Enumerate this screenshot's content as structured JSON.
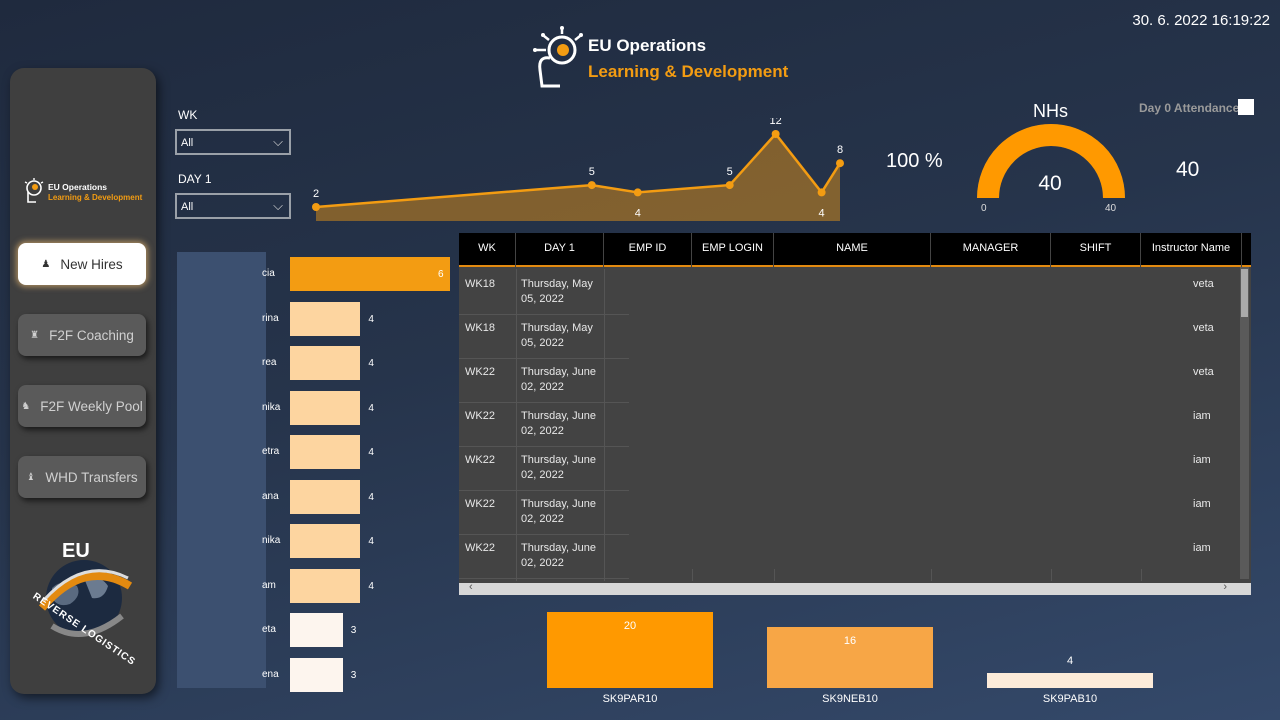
{
  "header": {
    "title_line1": "EU Operations",
    "title_line2": "Learning & Development",
    "datetime": "30. 6. 2022 16:19:22"
  },
  "sidebar": {
    "logo_line1": "EU Operations",
    "logo_line2": "Learning & Development",
    "nav": [
      {
        "label": "New Hires",
        "icon": "person-icon"
      },
      {
        "label": "F2F Coaching",
        "icon": "chess-icon"
      },
      {
        "label": "F2F Weekly Pool",
        "icon": "chess-icon"
      },
      {
        "label": "WHD Transfers",
        "icon": "chess-icon"
      }
    ],
    "brand_top": "EU",
    "brand_ring": "REVERSE LOGISTICS"
  },
  "filters": {
    "wk_label": "WK",
    "wk_value": "All",
    "day1_label": "DAY 1",
    "day1_value": "All"
  },
  "kpis": {
    "attendance_pct": "100 %",
    "nhs_title": "NHs",
    "nhs_value": "40",
    "gauge_min": "0",
    "gauge_max": "40",
    "gauge_fraction": 1.0,
    "right_value": "40",
    "attendance_label": "Day 0 Attendance"
  },
  "chart_data": [
    {
      "type": "area",
      "x_index": [
        0,
        6,
        7,
        9,
        10,
        11,
        11.4
      ],
      "values": [
        2,
        5,
        4,
        5,
        12,
        4,
        8
      ],
      "labels": [
        "2",
        "5",
        "4",
        "5",
        "12",
        "4",
        "8"
      ],
      "color": "#f39c12"
    },
    {
      "type": "bar",
      "orientation": "horizontal",
      "categories": [
        "cia",
        "rina",
        "rea",
        "nika",
        "etra",
        "ana",
        "nika",
        "am",
        "eta",
        "ena"
      ],
      "values": [
        6,
        4,
        4,
        4,
        4,
        4,
        4,
        4,
        3,
        3
      ],
      "colors": [
        "#f39c12",
        "#fdd5a0",
        "#fdd5a0",
        "#fdd5a0",
        "#fdd5a0",
        "#fdd5a0",
        "#fdd5a0",
        "#fdd5a0",
        "#fdf5ee",
        "#fdf5ee"
      ]
    },
    {
      "type": "bar",
      "categories": [
        "SK9PAR10",
        "SK9NEB10",
        "SK9PAB10"
      ],
      "values": [
        20,
        16,
        4
      ],
      "colors": [
        "#ff9900",
        "#f7a646",
        "#fcebd9"
      ]
    }
  ],
  "table": {
    "columns": [
      "WK",
      "DAY 1",
      "EMP ID",
      "EMP LOGIN",
      "NAME",
      "MANAGER",
      "SHIFT",
      "Instructor Name"
    ],
    "rows": [
      {
        "wk": "WK18",
        "day1_a": "Thursday, May",
        "day1_b": "05, 2022",
        "instructor": "veta"
      },
      {
        "wk": "WK18",
        "day1_a": "Thursday, May",
        "day1_b": "05, 2022",
        "instructor": "veta"
      },
      {
        "wk": "WK22",
        "day1_a": "Thursday, June",
        "day1_b": "02, 2022",
        "instructor": "veta"
      },
      {
        "wk": "WK22",
        "day1_a": "Thursday, June",
        "day1_b": "02, 2022",
        "instructor": "iam"
      },
      {
        "wk": "WK22",
        "day1_a": "Thursday, June",
        "day1_b": "02, 2022",
        "instructor": "iam"
      },
      {
        "wk": "WK22",
        "day1_a": "Thursday, June",
        "day1_b": "02, 2022",
        "instructor": "iam"
      },
      {
        "wk": "WK22",
        "day1_a": "Thursday, June",
        "day1_b": "02, 2022",
        "instructor": "iam"
      }
    ]
  }
}
